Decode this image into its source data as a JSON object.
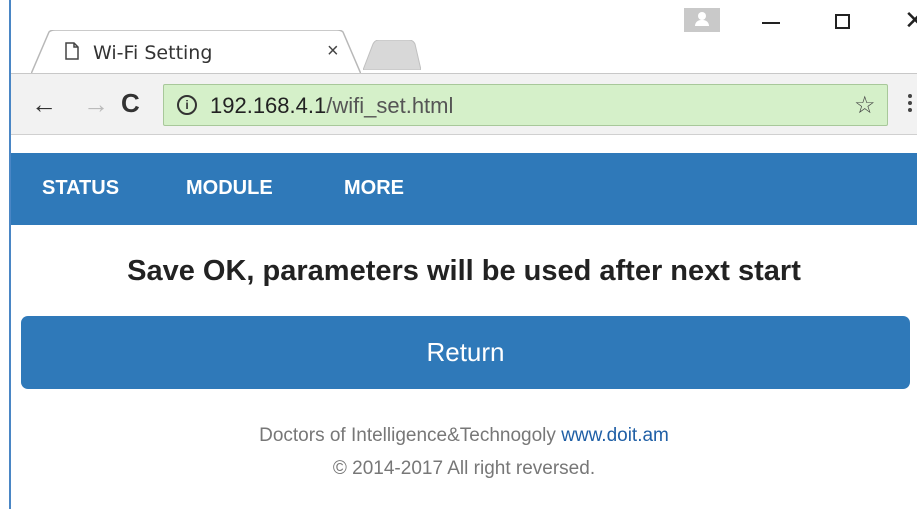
{
  "browser": {
    "tab_title": "Wi-Fi Setting",
    "tab_close": "×",
    "url_host": "192.168.4.1",
    "url_path": "/wifi_set.html",
    "info_glyph": "i",
    "star_glyph": "☆",
    "back_glyph": "←",
    "forward_glyph": "→",
    "reload_glyph": "C",
    "window_close_glyph": "✕",
    "omnibox_color": "#d5f0c9"
  },
  "nav": {
    "items": [
      {
        "label": "STATUS"
      },
      {
        "label": "MODULE"
      },
      {
        "label": "MORE"
      }
    ],
    "color": "#2f79b9"
  },
  "main": {
    "message": "Save OK, parameters will be used after next start",
    "return_label": "Return"
  },
  "footer": {
    "company": "Doctors of Intelligence&Technogoly",
    "link": "www.doit.am",
    "copyright": "© 2014-2017 All right reversed."
  }
}
